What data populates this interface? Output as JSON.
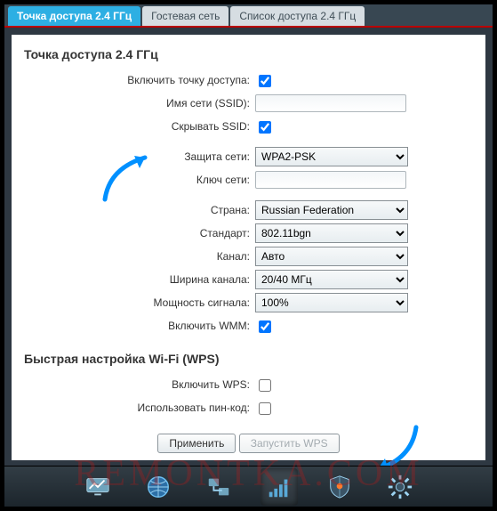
{
  "tabs": {
    "active": "Точка доступа 2.4 ГГц",
    "guest": "Гостевая сеть",
    "acl": "Список доступа 2.4 ГГц"
  },
  "section_ap": "Точка доступа 2.4 ГГц",
  "section_wps": "Быстрая настройка Wi-Fi (WPS)",
  "labels": {
    "enable_ap": "Включить точку доступа:",
    "ssid": "Имя сети (SSID):",
    "hide_ssid": "Скрывать SSID:",
    "security": "Защита сети:",
    "key": "Ключ сети:",
    "country": "Страна:",
    "standard": "Стандарт:",
    "channel": "Канал:",
    "width": "Ширина канала:",
    "power": "Мощность сигнала:",
    "wmm": "Включить WMM:",
    "wps_enable": "Включить WPS:",
    "wps_pin": "Использовать пин-код:"
  },
  "values": {
    "enable_ap": true,
    "ssid": "",
    "hide_ssid": true,
    "security": "WPA2-PSK",
    "key": "",
    "country": "Russian Federation",
    "standard": "802.11bgn",
    "channel": "Авто",
    "width": "20/40 МГц",
    "power": "100%",
    "wmm": true,
    "wps_enable": false,
    "wps_pin": false
  },
  "buttons": {
    "apply": "Применить",
    "start_wps": "Запустить WPS"
  },
  "watermark": "REMONTKA.COM",
  "iconbar": [
    "monitor-icon",
    "globe-icon",
    "network-icon",
    "wifi-signal-icon",
    "shield-icon",
    "gear-icon"
  ],
  "iconbar_active_index": 3,
  "colors": {
    "tab_active": "#2dafe3",
    "tab_accent": "#b90000",
    "arrow": "#0090ff"
  }
}
